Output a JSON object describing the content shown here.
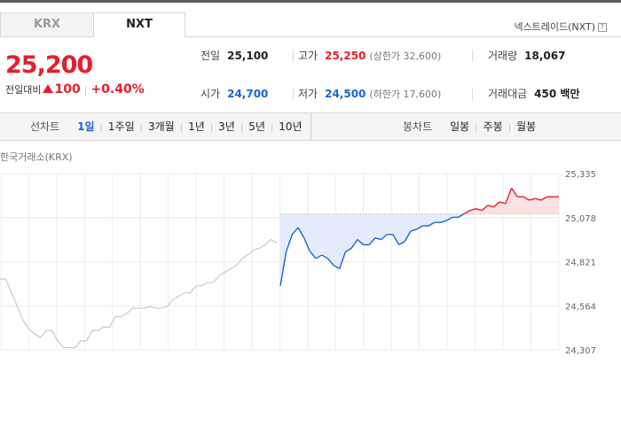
{
  "tabs": [
    {
      "label": "KRX"
    },
    {
      "label": "NXT"
    }
  ],
  "exchange_name": "넥스트레이드(NXT)",
  "help_glyph": "?",
  "quote": {
    "price": "25,200",
    "change_label": "전일대비",
    "change_amount": "100",
    "change_pct": "+0.40%"
  },
  "summary": {
    "prev_close_label": "전일",
    "prev_close": "25,100",
    "high_label": "고가",
    "high": "25,250",
    "upper_limit": "(상한가 32,600)",
    "volume_label": "거래량",
    "volume": "18,067",
    "open_label": "시가",
    "open": "24,700",
    "low_label": "저가",
    "low": "24,500",
    "lower_limit": "(하한가 17,600)",
    "amount_label": "거래대금",
    "amount": "450 백만"
  },
  "line_chart": {
    "label": "선차트",
    "periods": [
      "1일",
      "1주일",
      "3개월",
      "1년",
      "3년",
      "5년",
      "10년"
    ],
    "active": "1일"
  },
  "candle_chart": {
    "label": "봉차트",
    "periods": [
      "일봉",
      "주봉",
      "월봉"
    ]
  },
  "chart_source": "한국거래소(KRX)",
  "chart_data": {
    "type": "line",
    "yticks": [
      "25,335",
      "25,078",
      "24,821",
      "24,564",
      "24,307"
    ],
    "ylim": [
      24307,
      25335
    ],
    "reference_price": 25100,
    "grid": true,
    "series": [
      {
        "color": "#c8c8c8",
        "values": [
          24720,
          24720,
          24640,
          24560,
          24480,
          24430,
          24400,
          24380,
          24420,
          24420,
          24360,
          24320,
          24320,
          24320,
          24360,
          24360,
          24420,
          24420,
          24440,
          24440,
          24500,
          24500,
          24520,
          24550,
          24550,
          24550,
          24560,
          24550,
          24550,
          24560,
          24600,
          24620,
          24640,
          24640,
          24680,
          24680,
          24700,
          24700,
          24740,
          24760,
          24780,
          24800,
          24840,
          24860,
          24890,
          24900,
          24920,
          24950,
          24930
        ]
      },
      {
        "color_down": "#1a63d3",
        "color_up": "#e61e2b",
        "values": [
          24680,
          24880,
          24980,
          25020,
          24960,
          24880,
          24840,
          24860,
          24840,
          24800,
          24780,
          24880,
          24900,
          24950,
          24920,
          24920,
          24960,
          24950,
          24980,
          24980,
          24920,
          24940,
          25000,
          25010,
          25030,
          25030,
          25050,
          25050,
          25060,
          25080,
          25080,
          25100,
          25120,
          25130,
          25120,
          25150,
          25140,
          25170,
          25160,
          25250,
          25200,
          25200,
          25180,
          25190,
          25180,
          25200,
          25200,
          25200
        ]
      }
    ]
  }
}
